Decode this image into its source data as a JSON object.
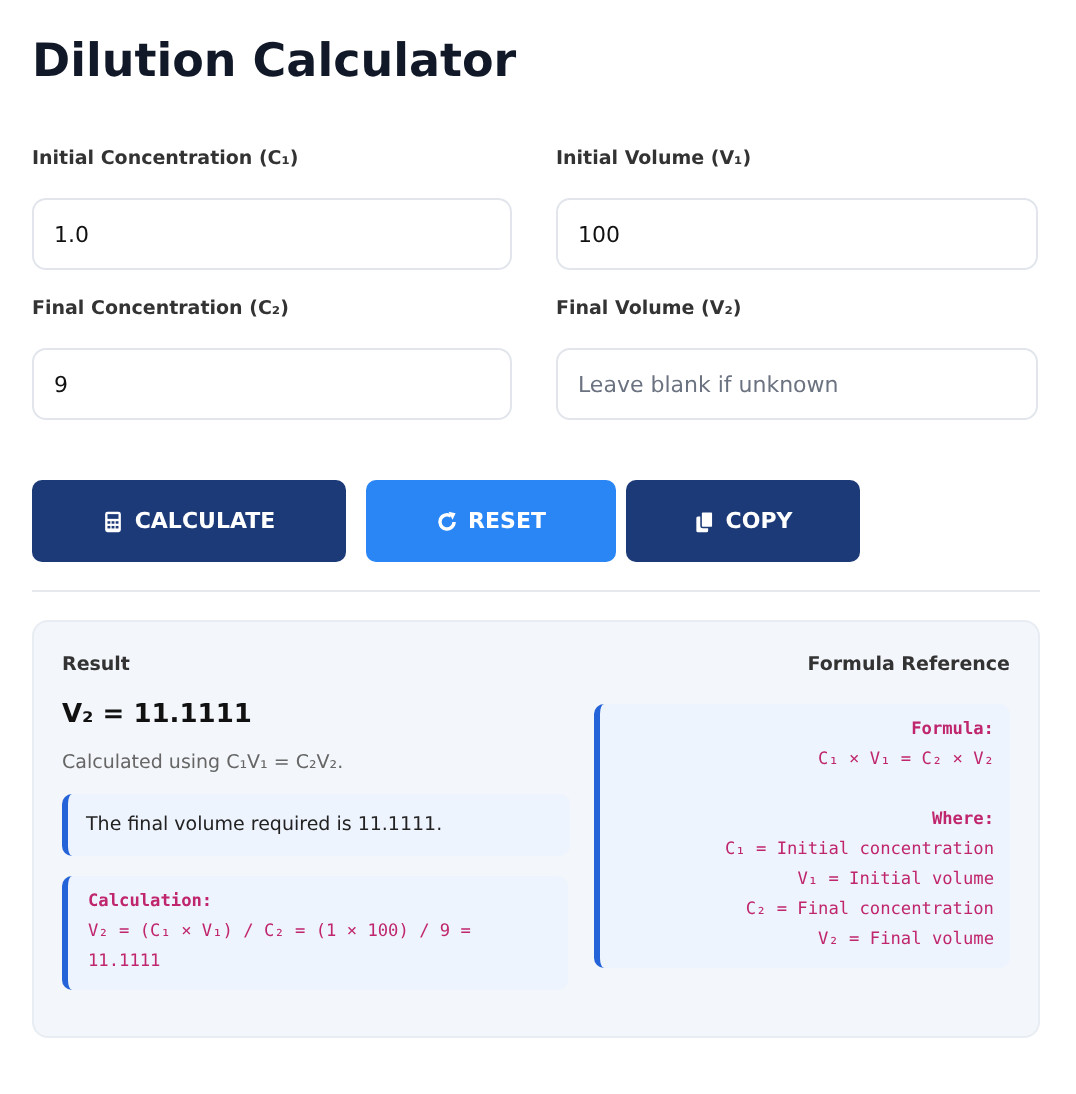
{
  "title": "Dilution Calculator",
  "fields": [
    {
      "label": "Initial Concentration (C₁)",
      "value": "1.0"
    },
    {
      "label": "Initial Volume (V₁)",
      "value": "100"
    },
    {
      "label": "Final Concentration (C₂)",
      "value": "9"
    },
    {
      "label": "Final Volume (V₂)",
      "placeholder": "Leave blank if unknown"
    }
  ],
  "buttons": [
    {
      "label": "CALCULATE",
      "kind": "dark"
    },
    {
      "label": "RESET",
      "kind": "light"
    },
    {
      "label": "COPY",
      "kind": "dark"
    }
  ],
  "result": {
    "heading": "Result",
    "value": "V₂ = 11.1111",
    "method": "Calculated using C₁V₁ = C₂V₂.",
    "message": "The final volume required is 11.1111.",
    "calculation": {
      "heading": "Calculation:",
      "text": "V₂ = (C₁ × V₁) / C₂ = (1 × 100) / 9 = 11.1111"
    }
  },
  "reference": {
    "heading": "Formula Reference",
    "formula_heading": "Formula:",
    "formula": "C₁ × V₁ = C₂ × V₂",
    "where_heading": "Where:",
    "definitions": [
      "C₁ = Initial concentration",
      "V₁ = Initial volume",
      "C₂ = Final concentration",
      "V₂ = Final volume"
    ]
  }
}
